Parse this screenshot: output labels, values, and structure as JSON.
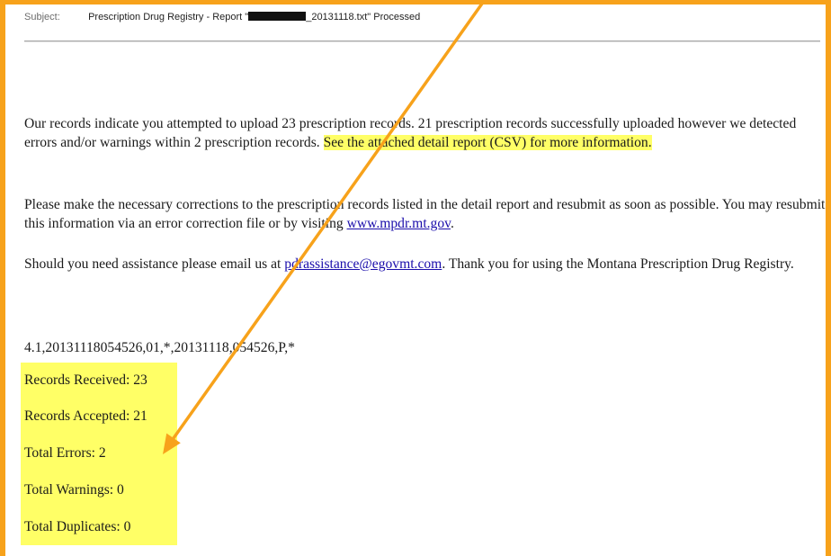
{
  "email": {
    "subject_label": "Subject:",
    "subject_prefix": "Prescription Drug Registry - Report \"",
    "subject_suffix": "_20131118.txt\" Processed",
    "para1_text": "Our records indicate you attempted to upload 23 prescription records. 21 prescription records successfully uploaded however we detected errors and/or warnings within 2 prescription records. ",
    "para1_highlight": "See the attached detail report (CSV) for more information.",
    "para2_text": "Please make the necessary corrections to the prescription records listed in the detail report and resubmit as soon as possible. You may resubmit this information via an error correction file or by visiting ",
    "para2_link": "www.mpdr.mt.gov",
    "para2_end": ".",
    "para3_start": "Should you need assistance please email us at ",
    "para3_link": "pdrassistance@egovmt.com",
    "para3_end": ". Thank you for using the Montana Prescription Drug Registry.",
    "record_line": "4.1,20131118054526,01,*,20131118,054526,P,*",
    "totals": [
      "Records Received: 23",
      "Records Accepted: 21",
      "Total Errors: 2",
      "Total Warnings: 0",
      "Total Duplicates: 0"
    ]
  },
  "colors": {
    "frame": "#F7A21B",
    "arrow": "#F7A21B",
    "highlight": "#FFFF66",
    "link": "#1a0dab"
  },
  "icons": {
    "redaction": "black-redaction-bar",
    "annotation": "orange-arrow"
  }
}
